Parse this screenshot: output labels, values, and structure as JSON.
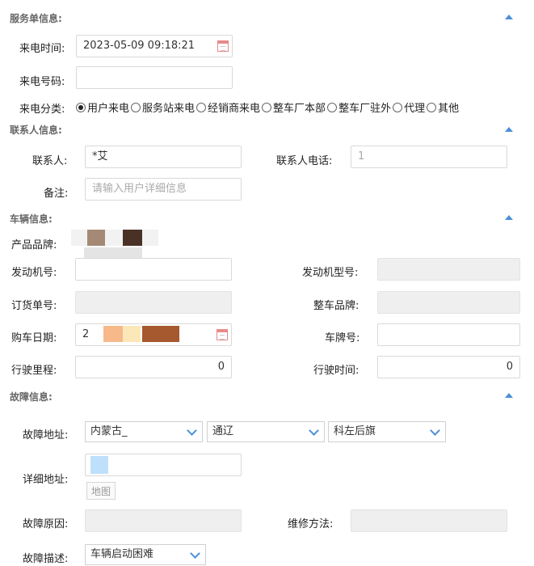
{
  "sections": {
    "service": "服务单信息:",
    "contact": "联系人信息:",
    "vehicle": "车辆信息:",
    "fault": "故障信息:"
  },
  "service": {
    "call_time_label": "来电时间:",
    "call_time_value": "2023-05-09 09:18:21",
    "call_number_label": "来电号码:",
    "call_number_value": "",
    "call_type_label": "来电分类:",
    "call_types": [
      "用户来电",
      "服务站来电",
      "经销商来电",
      "整车厂本部",
      "整车厂驻外",
      "代理",
      "其他"
    ],
    "call_type_selected": 0
  },
  "contact": {
    "name_label": "联系人:",
    "name_value": "*艾",
    "phone_label": "联系人电话:",
    "phone_value": "1",
    "remark_label": "备注:",
    "remark_placeholder": "请输入用户详细信息"
  },
  "vehicle": {
    "brand_label": "产品品牌:",
    "engine_no_label": "发动机号:",
    "engine_model_label": "发动机型号:",
    "order_no_label": "订货单号:",
    "vehicle_brand_label": "整车品牌:",
    "purchase_date_label": "购车日期:",
    "purchase_date_value": "2",
    "plate_label": "车牌号:",
    "plate_value": "",
    "mileage_label": "行驶里程:",
    "mileage_value": "0",
    "drive_time_label": "行驶时间:",
    "drive_time_value": "0"
  },
  "fault": {
    "address_label": "故障地址:",
    "province": "内蒙古_",
    "city": "通辽",
    "county": "科左后旗",
    "detail_label": "详细地址:",
    "map_button": "地图",
    "cause_label": "故障原因:",
    "repair_label": "维修方法:",
    "desc_label": "故障描述:",
    "desc_value": "车辆启动困难"
  }
}
